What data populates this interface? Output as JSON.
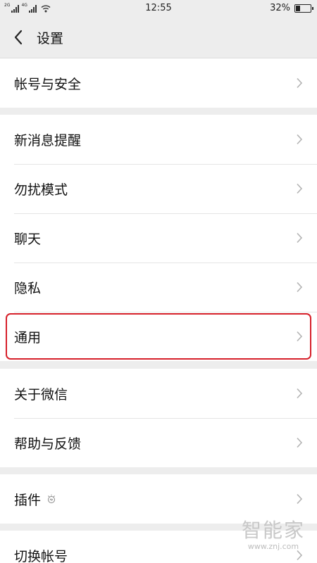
{
  "status_bar": {
    "network_left": "2G",
    "network_right": "4G",
    "time": "12:55",
    "battery_percent_text": "32%",
    "battery_level": 0.32
  },
  "header": {
    "back_icon": "chevron-left-icon",
    "title": "设置"
  },
  "groups": {
    "account": {
      "items": [
        {
          "label": "帐号与安全"
        }
      ]
    },
    "main": {
      "items": [
        {
          "label": "新消息提醒"
        },
        {
          "label": "勿扰模式"
        },
        {
          "label": "聊天"
        },
        {
          "label": "隐私"
        },
        {
          "label": "通用",
          "highlighted": true
        }
      ]
    },
    "about": {
      "items": [
        {
          "label": "关于微信"
        },
        {
          "label": "帮助与反馈"
        }
      ]
    },
    "plugins": {
      "items": [
        {
          "label": "插件",
          "icon": "plugin-badge-icon"
        }
      ]
    },
    "switch": {
      "items": [
        {
          "label": "切换帐号"
        }
      ]
    }
  },
  "watermark": {
    "logo": "智能家",
    "url": "www.znj.com"
  },
  "colors": {
    "background": "#ededed",
    "row_background": "#ffffff",
    "highlight_border": "#d6202a",
    "chevron": "#b3b3b3"
  }
}
